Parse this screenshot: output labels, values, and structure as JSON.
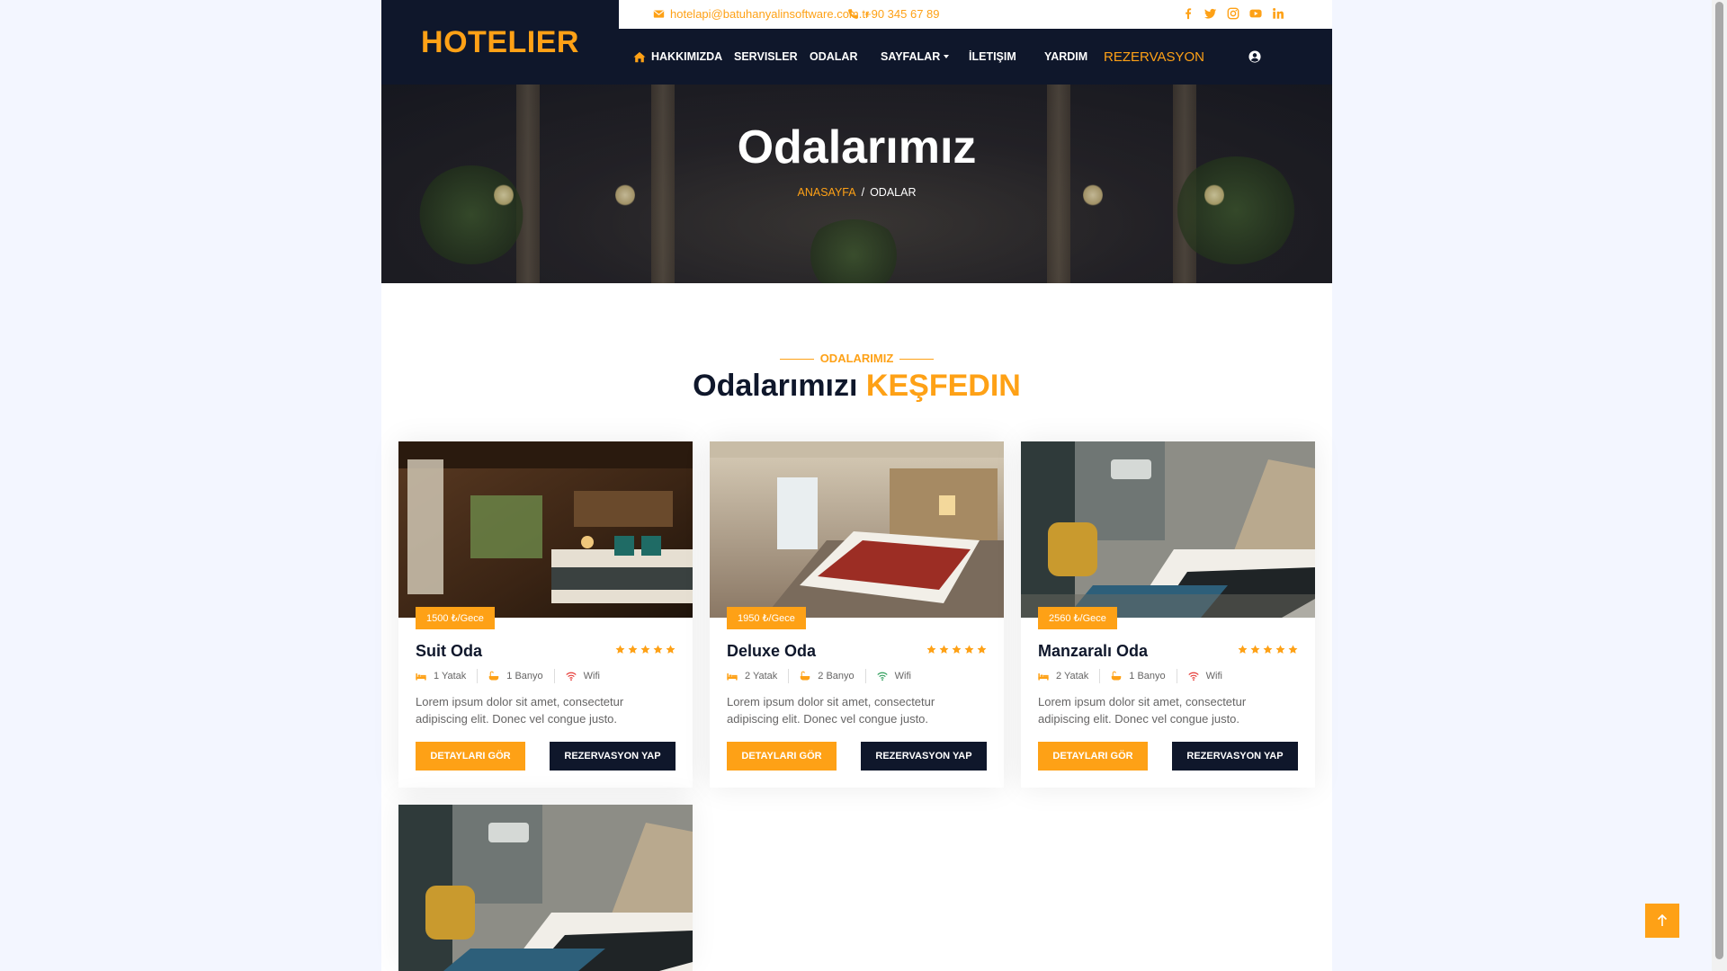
{
  "brand": {
    "name": "HOTELIER"
  },
  "topbar": {
    "email": "hotelapi@batuhanyalinsoftware.com.tr",
    "phone": "+90 345 67 89",
    "socials": [
      "facebook-icon",
      "twitter-icon",
      "instagram-icon",
      "youtube-icon",
      "linkedin-icon"
    ]
  },
  "nav": {
    "items": [
      "HAKKIMIZDA",
      "SERVISLER",
      "ODALAR",
      "SAYFALAR",
      "İLETIŞIM",
      "YARDIM",
      "REZERVASYON"
    ]
  },
  "hero": {
    "title": "Odalarımız",
    "breadcrumb_home": "ANASAYFA",
    "breadcrumb_sep": "/",
    "breadcrumb_current": "ODALAR"
  },
  "section": {
    "subtitle": "ODALARIMIZ",
    "title_main": "Odalarımızı",
    "title_accent": "KEŞFEDIN"
  },
  "rooms": [
    {
      "price": "1500 ₺/Gece",
      "name": "Suit Oda",
      "rating": 5,
      "beds": "1 Yatak",
      "baths": "1 Banyo",
      "wifi": "Wifi",
      "description": "Lorem ipsum dolor sit amet, consectetur adipiscing elit. Donec vel congue justo.",
      "detail_label": "DETAYLARI GÖR",
      "book_label": "REZERVASYON YAP"
    },
    {
      "price": "1950 ₺/Gece",
      "name": "Deluxe Oda",
      "rating": 5,
      "beds": "2 Yatak",
      "baths": "2 Banyo",
      "wifi": "Wifi",
      "description": "Lorem ipsum dolor sit amet, consectetur adipiscing elit. Donec vel congue justo.",
      "detail_label": "DETAYLARI GÖR",
      "book_label": "REZERVASYON YAP"
    },
    {
      "price": "2560 ₺/Gece",
      "name": "Manzaralı Oda",
      "rating": 5,
      "beds": "2 Yatak",
      "baths": "1 Banyo",
      "wifi": "Wifi",
      "description": "Lorem ipsum dolor sit amet, consectetur adipiscing elit. Donec vel congue justo.",
      "detail_label": "DETAYLARI GÖR",
      "book_label": "REZERVASYON YAP"
    }
  ],
  "colors": {
    "primary": "#fea116",
    "dark": "#0f172b",
    "wifi_red": "#e53935",
    "wifi_green": "#2e9e5b"
  }
}
